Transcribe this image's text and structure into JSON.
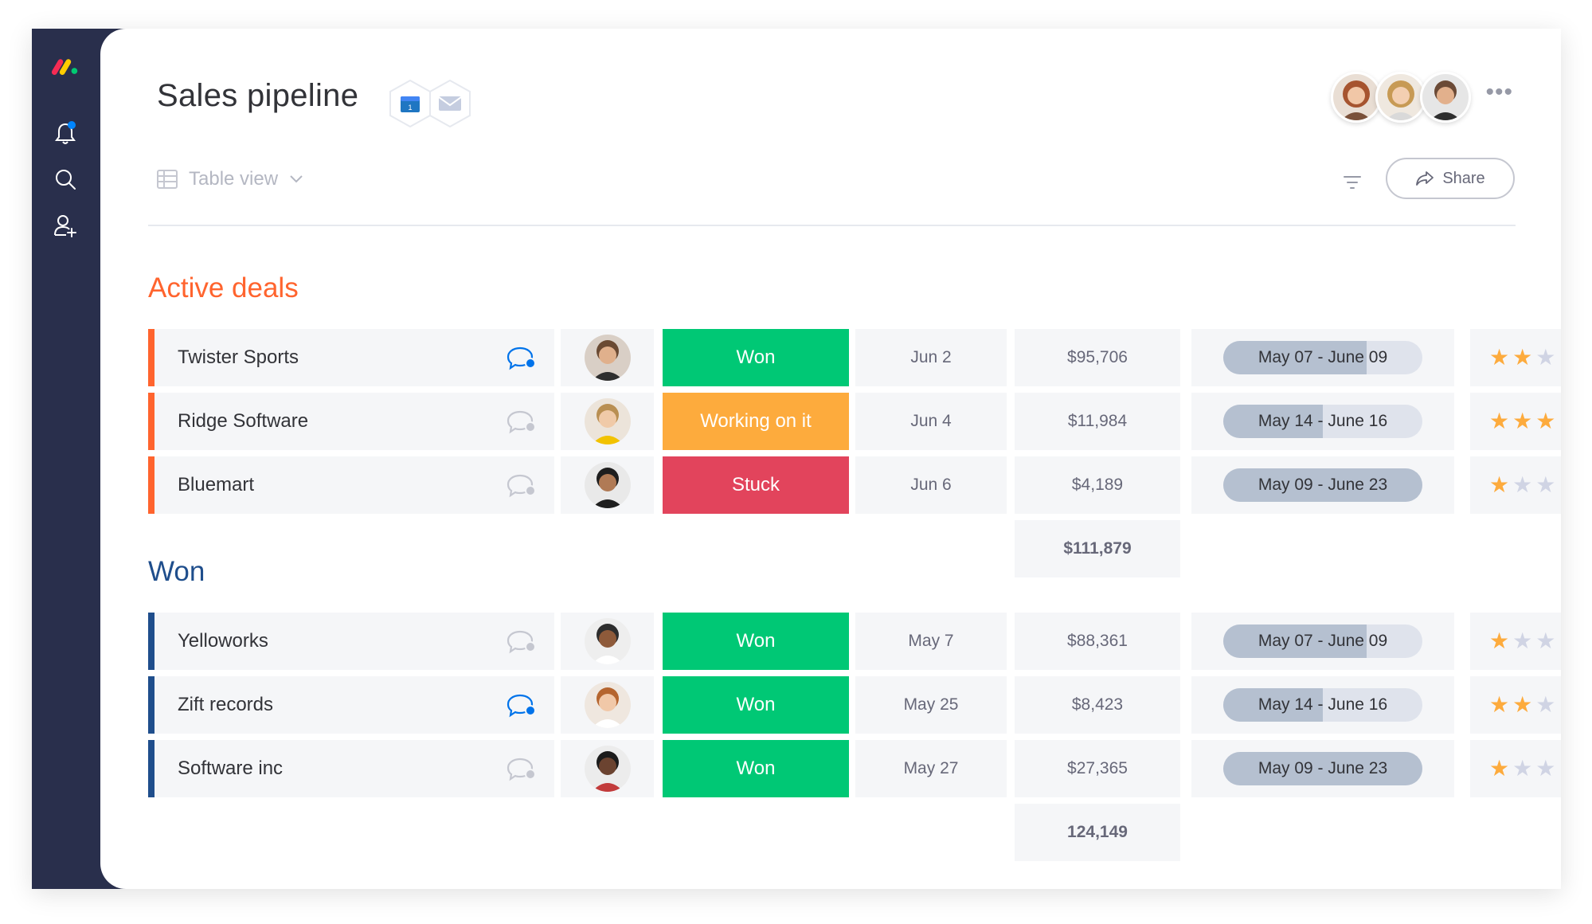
{
  "header": {
    "title": "Sales pipeline",
    "integrations": [
      {
        "name": "calendar-icon",
        "badge": "1"
      },
      {
        "name": "mail-icon"
      }
    ],
    "members": [
      "member-avatar-1",
      "member-avatar-2",
      "member-avatar-3"
    ],
    "more_label": "•••"
  },
  "toolbar": {
    "view_label": "Table view",
    "share_label": "Share"
  },
  "groups": [
    {
      "title": "Active deals",
      "color": "#ff642e",
      "rows": [
        {
          "name": "Twister Sports",
          "chat_active": true,
          "status": "Won",
          "status_color": "#00c875",
          "date": "Jun 2",
          "amount": "$95,706",
          "timeline": "May 07 - June 09",
          "timeline_progress": 0.72,
          "rating": 2
        },
        {
          "name": "Ridge Software",
          "chat_active": false,
          "status": "Working on it",
          "status_color": "#fdab3d",
          "date": "Jun 4",
          "amount": "$11,984",
          "timeline": "May 14 - June 16",
          "timeline_progress": 0.5,
          "rating": 3
        },
        {
          "name": "Bluemart",
          "chat_active": false,
          "status": "Stuck",
          "status_color": "#e2445c",
          "date": "Jun 6",
          "amount": "$4,189",
          "timeline": "May 09 - June 23",
          "timeline_progress": 1.0,
          "rating": 1
        }
      ],
      "total": "$111,879"
    },
    {
      "title": "Won",
      "color": "#1f4e8c",
      "rows": [
        {
          "name": "Yelloworks",
          "chat_active": false,
          "status": "Won",
          "status_color": "#00c875",
          "date": "May 7",
          "amount": "$88,361",
          "timeline": "May 07 - June 09",
          "timeline_progress": 0.72,
          "rating": 1
        },
        {
          "name": "Zift records",
          "chat_active": true,
          "status": "Won",
          "status_color": "#00c875",
          "date": "May 25",
          "amount": "$8,423",
          "timeline": "May 14 - June 16",
          "timeline_progress": 0.5,
          "rating": 2
        },
        {
          "name": "Software inc",
          "chat_active": false,
          "status": "Won",
          "status_color": "#00c875",
          "date": "May 27",
          "amount": "$27,365",
          "timeline": "May 09 - June 23",
          "timeline_progress": 1.0,
          "rating": 1
        }
      ],
      "total": "124,149"
    }
  ],
  "rating_max": 3,
  "colors": {
    "sidebar": "#292f4c",
    "star_on": "#fdab3d",
    "star_off": "#d0d4e4",
    "chat_active": "#0073ea",
    "chat_inactive": "#c5c7d0"
  }
}
